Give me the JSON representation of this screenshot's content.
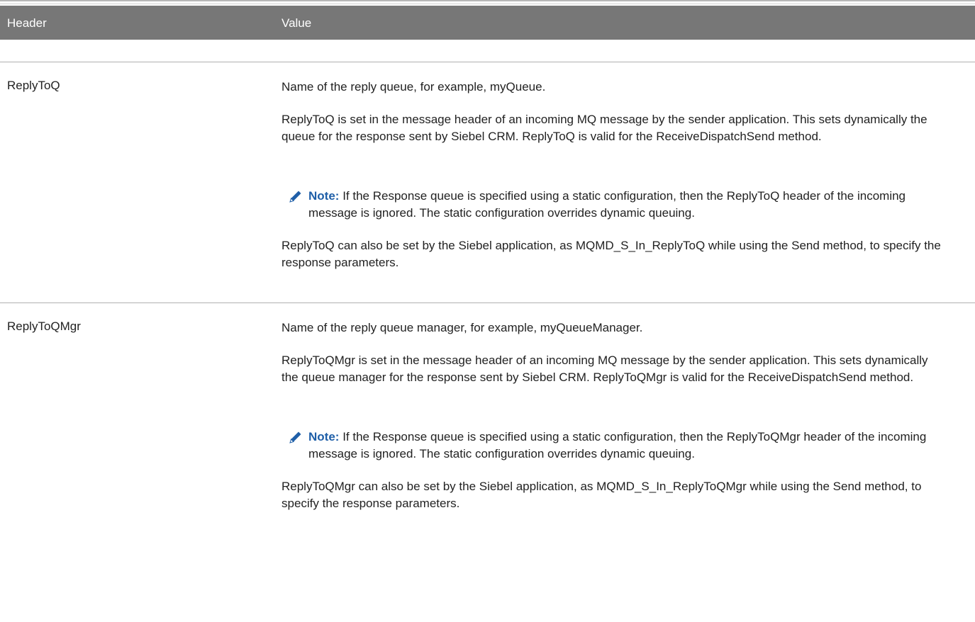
{
  "table": {
    "headers": [
      "Header",
      "Value"
    ],
    "rows": [
      {
        "name": "ReplyToQ",
        "paragraphs": [
          "Name of the reply queue, for example, myQueue.",
          "ReplyToQ is set in the message header of an incoming MQ message by the sender application. This sets dynamically the queue for the response sent by Siebel CRM. ReplyToQ is valid for the ReceiveDispatchSend method."
        ],
        "note_label": "Note:",
        "note_text": "If the Response queue is specified using a static configuration, then the ReplyToQ header of the incoming message is ignored. The static configuration overrides dynamic queuing.",
        "after_note": "ReplyToQ can also be set by the Siebel application, as MQMD_S_In_ReplyToQ while using the Send method, to specify the response parameters."
      },
      {
        "name": "ReplyToQMgr",
        "paragraphs": [
          "Name of the reply queue manager, for example, myQueueManager.",
          "ReplyToQMgr is set in the message header of an incoming MQ message by the sender application. This sets dynamically the queue manager for the response sent by Siebel CRM. ReplyToQMgr is valid for the ReceiveDispatchSend method."
        ],
        "note_label": "Note:",
        "note_text": "If the Response queue is specified using a static configuration, then the ReplyToQMgr header of the incoming message is ignored. The static configuration overrides dynamic queuing.",
        "after_note": "ReplyToQMgr can also be set by the Siebel application, as MQMD_S_In_ReplyToQMgr while using the Send method, to specify the response parameters."
      }
    ]
  },
  "colors": {
    "header_bg": "#777777",
    "note_label": "#1f5fa8",
    "pencil_icon": "#1f5fa8"
  },
  "icons": {
    "note": "pencil-icon"
  }
}
